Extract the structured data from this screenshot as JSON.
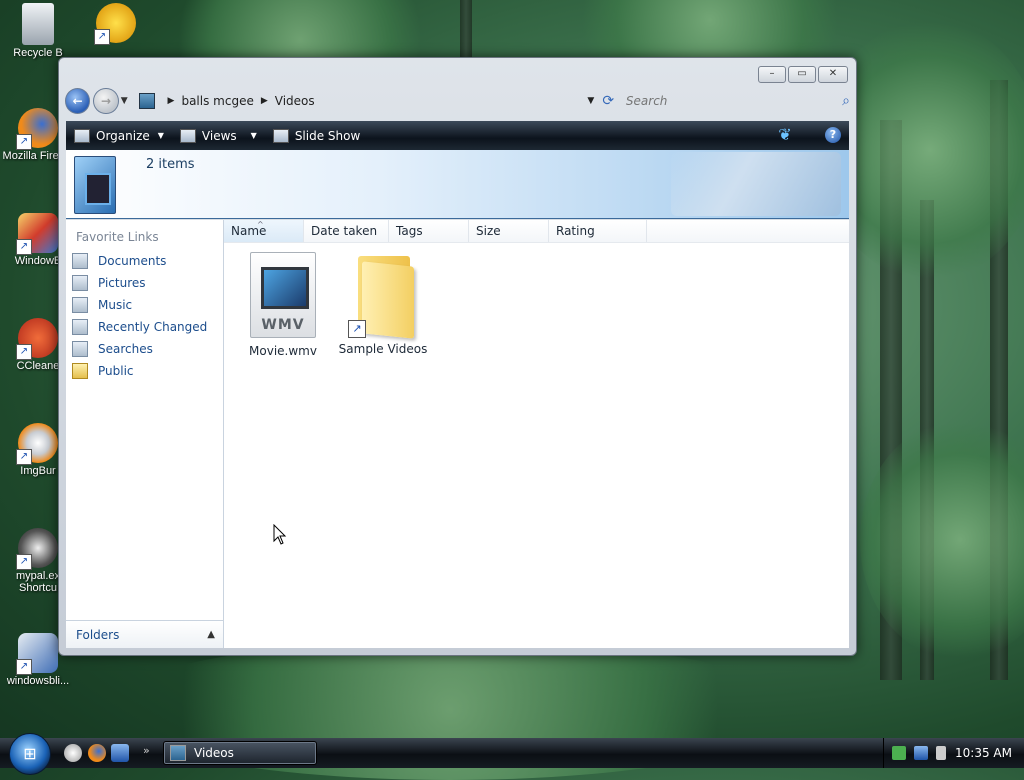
{
  "desktop": {
    "icons": [
      {
        "label": "Recycle B",
        "icon": "recycle-bin-icon"
      },
      {
        "label": "",
        "icon": "yahoo-messenger-icon"
      },
      {
        "label": "Mozilla Firefox",
        "icon": "firefox-icon"
      },
      {
        "label": "WindowB",
        "icon": "windowblinds-icon"
      },
      {
        "label": "CCleane",
        "icon": "ccleaner-icon"
      },
      {
        "label": "ImgBur",
        "icon": "imgburn-icon"
      },
      {
        "label": "mypal.ex Shortcu",
        "icon": "raccoon-icon"
      },
      {
        "label": "windowsbli...",
        "icon": "windowsblinds-settings-icon"
      }
    ]
  },
  "window": {
    "caption_buttons": {
      "minimize": "–",
      "maximize": "▭",
      "close": "✕"
    },
    "address": {
      "segments": [
        "balls mcgee",
        "Videos"
      ]
    },
    "search": {
      "placeholder": "Search"
    },
    "toolbar": {
      "organize": "Organize",
      "views": "Views",
      "slideshow": "Slide Show",
      "help": "?"
    },
    "info": {
      "count": "2 items"
    },
    "navpane": {
      "heading": "Favorite Links",
      "links": [
        {
          "label": "Documents",
          "icon": "documents-icon"
        },
        {
          "label": "Pictures",
          "icon": "pictures-icon"
        },
        {
          "label": "Music",
          "icon": "music-icon"
        },
        {
          "label": "Recently Changed",
          "icon": "recently-changed-icon"
        },
        {
          "label": "Searches",
          "icon": "searches-icon"
        },
        {
          "label": "Public",
          "icon": "public-folder-icon"
        }
      ],
      "folders": "Folders"
    },
    "columns": [
      "Name",
      "Date taken",
      "Tags",
      "Size",
      "Rating"
    ],
    "files": [
      {
        "name": "Movie.wmv",
        "type": "wmv",
        "tag": "WMV"
      },
      {
        "name": "Sample Videos",
        "type": "folder-shortcut"
      }
    ]
  },
  "taskbar": {
    "start": "⊞",
    "quicklaunch_more": "»",
    "task": "Videos",
    "clock": "10:35 AM"
  }
}
